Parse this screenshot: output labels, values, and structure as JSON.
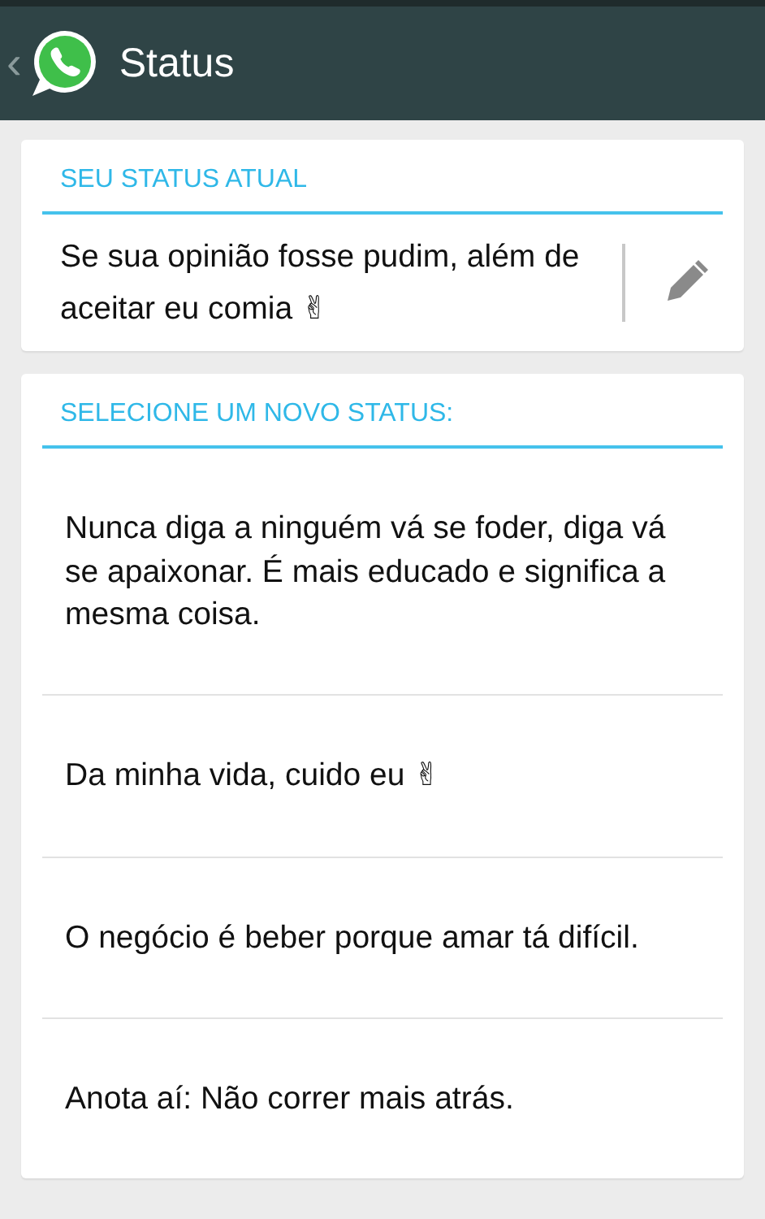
{
  "header": {
    "back": "‹",
    "title": "Status"
  },
  "current": {
    "heading": "SEU STATUS ATUAL",
    "text": "Se sua opinião fosse pudim, além de aceitar eu comia ✌"
  },
  "options": {
    "heading": "SELECIONE UM NOVO STATUS:",
    "items": [
      {
        "text": "Nunca diga a ninguém vá se foder, diga vá se apaixonar. É mais educado e significa a mesma coisa."
      },
      {
        "text": "Da minha vida, cuido eu ✌"
      },
      {
        "text": "O negócio é beber porque amar tá difícil."
      },
      {
        "text": "Anota aí: Não correr mais atrás."
      }
    ]
  }
}
